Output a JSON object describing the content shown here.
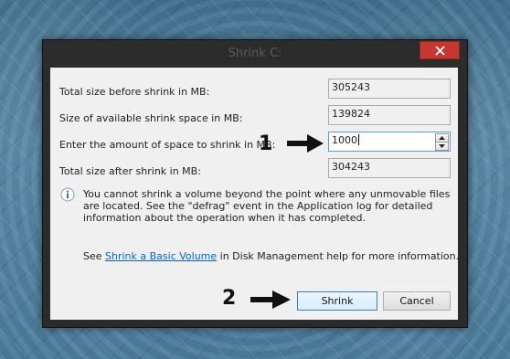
{
  "window": {
    "title": "Shrink C:"
  },
  "rows": [
    {
      "label": "Total size before shrink in MB:",
      "value": "305243"
    },
    {
      "label": "Size of available shrink space in MB:",
      "value": "139824"
    },
    {
      "label": "Enter the amount of space to shrink in MB:",
      "value": "1000"
    },
    {
      "label": "Total size after shrink in MB:",
      "value": "304243"
    }
  ],
  "info": {
    "text": "You cannot shrink a volume beyond the point where any unmovable files are located. See the \"defrag\" event in the Application log for detailed information about the operation when it has completed."
  },
  "help": {
    "prefix": "See ",
    "link": "Shrink a Basic Volume",
    "suffix": " in Disk Management help for more information."
  },
  "buttons": {
    "shrink": "Shrink",
    "cancel": "Cancel"
  },
  "annotations": {
    "step1": "1",
    "step2": "2"
  },
  "colors": {
    "close_button": "#c7372f",
    "link": "#0066cc",
    "focus_border": "#5c9bd7"
  }
}
